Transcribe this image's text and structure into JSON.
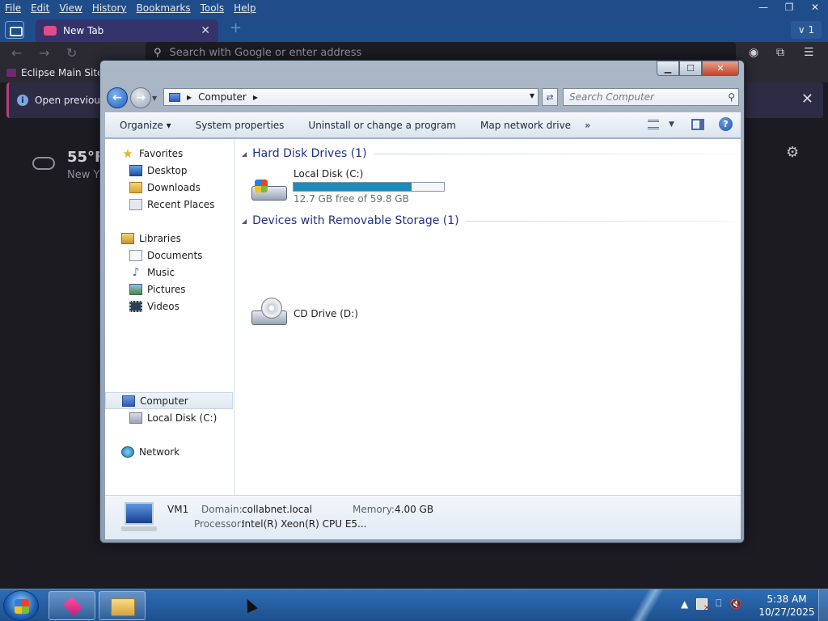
{
  "browser": {
    "menu": [
      "File",
      "Edit",
      "View",
      "History",
      "Bookmarks",
      "Tools",
      "Help"
    ],
    "tab_title": "New Tab",
    "tab_overflow_count": "1",
    "url_placeholder": "Search with Google or enter address",
    "bookmark": "Eclipse Main Site",
    "info_text": "Open previous",
    "weather_temp": "55°F",
    "weather_location": "New Y"
  },
  "explorer": {
    "address_location": "Computer",
    "search_placeholder": "Search Computer",
    "commands": [
      "Organize ▾",
      "System properties",
      "Uninstall or change a program",
      "Map network drive"
    ],
    "more_commands": "»",
    "nav": {
      "favorites": "Favorites",
      "desktop": "Desktop",
      "downloads": "Downloads",
      "recent": "Recent Places",
      "libraries": "Libraries",
      "documents": "Documents",
      "music": "Music",
      "pictures": "Pictures",
      "videos": "Videos",
      "computer": "Computer",
      "local_disk": "Local Disk (C:)",
      "network": "Network"
    },
    "groups": [
      {
        "title": "Hard Disk Drives (1)"
      },
      {
        "title": "Devices with Removable Storage (1)"
      }
    ],
    "drive_c": {
      "name": "Local Disk (C:)",
      "free_text": "12.7 GB free of 59.8 GB",
      "used_fraction": 0.787
    },
    "drive_d": {
      "name": "CD Drive (D:)"
    },
    "details": {
      "name": "VM1",
      "domain_label": "Domain:",
      "domain": "collabnet.local",
      "memory_label": "Memory:",
      "memory": "4.00 GB",
      "processor_label": "Processor:",
      "processor": "Intel(R) Xeon(R) CPU E5..."
    }
  },
  "taskbar": {
    "time": "5:38 AM",
    "date": "10/27/2025"
  },
  "colors": {
    "group_title": "#1e3287",
    "capacity_fill": "#1e8bb8",
    "taskbar": "#1e508d"
  }
}
